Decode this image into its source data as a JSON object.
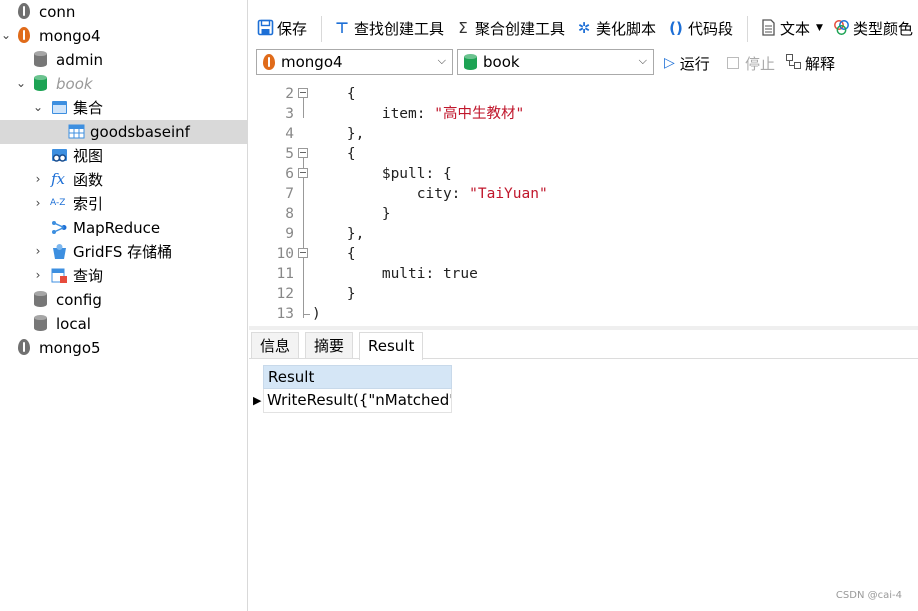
{
  "sidebar": {
    "items": [
      {
        "label": "conn",
        "icon": "leaf-gray-icon"
      },
      {
        "label": "mongo4",
        "icon": "leaf-orange-icon",
        "expanded": true
      },
      {
        "label": "admin",
        "icon": "database-gray-icon"
      },
      {
        "label": "book",
        "icon": "database-green-icon",
        "expanded": true
      },
      {
        "label": "集合",
        "icon": "collection-folder-icon",
        "expanded": true
      },
      {
        "label": "goodsbaseinf",
        "icon": "table-icon",
        "selected": true
      },
      {
        "label": "视图",
        "icon": "view-icon"
      },
      {
        "label": "函数",
        "icon": "function-icon"
      },
      {
        "label": "索引",
        "icon": "index-icon"
      },
      {
        "label": "MapReduce",
        "icon": "mapreduce-icon"
      },
      {
        "label": "GridFS 存储桶",
        "icon": "gridfs-icon"
      },
      {
        "label": "查询",
        "icon": "query-icon"
      },
      {
        "label": "config",
        "icon": "database-gray-icon"
      },
      {
        "label": "local",
        "icon": "database-gray-icon"
      },
      {
        "label": "mongo5",
        "icon": "leaf-gray-icon"
      }
    ]
  },
  "toolbar": {
    "save": "保存",
    "find_builder": "查找创建工具",
    "aggregate_builder": "聚合创建工具",
    "beautify": "美化脚本",
    "snippet": "代码段",
    "text": "文本",
    "type_color": "类型颜色"
  },
  "connbar": {
    "connection": "mongo4",
    "database": "book",
    "run": "运行",
    "stop": "停止",
    "explain": "解释"
  },
  "editor": {
    "lines": [
      {
        "n": "2",
        "pre": "    {",
        "str": "",
        "post": ""
      },
      {
        "n": "3",
        "pre": "        item: ",
        "str": "\"高中生教材\"",
        "post": ""
      },
      {
        "n": "4",
        "pre": "    },",
        "str": "",
        "post": ""
      },
      {
        "n": "5",
        "pre": "    {",
        "str": "",
        "post": ""
      },
      {
        "n": "6",
        "pre": "        $pull: {",
        "str": "",
        "post": ""
      },
      {
        "n": "7",
        "pre": "            city: ",
        "str": "\"TaiYuan\"",
        "post": ""
      },
      {
        "n": "8",
        "pre": "        }",
        "str": "",
        "post": ""
      },
      {
        "n": "9",
        "pre": "    },",
        "str": "",
        "post": ""
      },
      {
        "n": "10",
        "pre": "    {",
        "str": "",
        "post": ""
      },
      {
        "n": "11",
        "pre": "        multi: true",
        "str": "",
        "post": ""
      },
      {
        "n": "12",
        "pre": "    }",
        "str": "",
        "post": ""
      },
      {
        "n": "13",
        "pre": ")",
        "str": "",
        "post": ""
      }
    ]
  },
  "result_tabs": [
    "信息",
    "摘要",
    "Result"
  ],
  "result_grid": {
    "header": "Result",
    "row": "WriteResult({\"nMatched\""
  },
  "watermark": "CSDN @cai-4",
  "colors": {
    "selected_row": "#d9d9d9",
    "grid_header": "#d5e6f6",
    "string": "#c0172c",
    "accent_blue": "#1d6fd6"
  }
}
